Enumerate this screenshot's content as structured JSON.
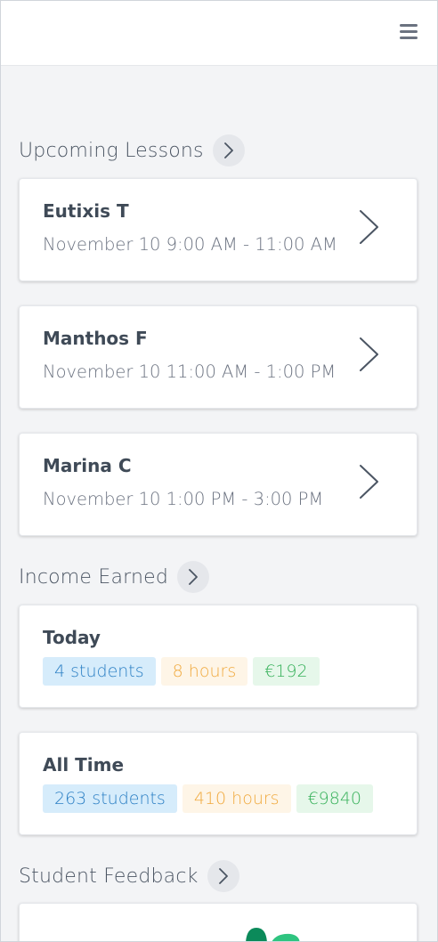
{
  "sections": {
    "upcoming": "Upcoming Lessons",
    "income": "Income Earned",
    "feedback": "Student Feedback"
  },
  "lessons": [
    {
      "name": "Eutixis T",
      "time": "November 10 9:00 AM - 11:00 AM"
    },
    {
      "name": "Manthos F",
      "time": "November 10 11:00 AM - 1:00 PM"
    },
    {
      "name": "Marina C",
      "time": "November 10 1:00 PM - 3:00 PM"
    }
  ],
  "income": {
    "today": {
      "label": "Today",
      "students": "4 students",
      "hours": "8 hours",
      "earned": "€192"
    },
    "all_time": {
      "label": "All Time",
      "students": "263 students",
      "hours": "410 hours",
      "earned": "€9840"
    }
  },
  "icons": {
    "menu": "hamburger-menu-icon",
    "chevron": "chevron-right-icon",
    "feedback_illustration": "leaf-illustration-icon"
  },
  "colors": {
    "students_chip": "#d6ecfb",
    "hours_chip": "#fef5e7",
    "money_chip": "#e6f7ea",
    "illustration_green": "#0b8a5a"
  }
}
